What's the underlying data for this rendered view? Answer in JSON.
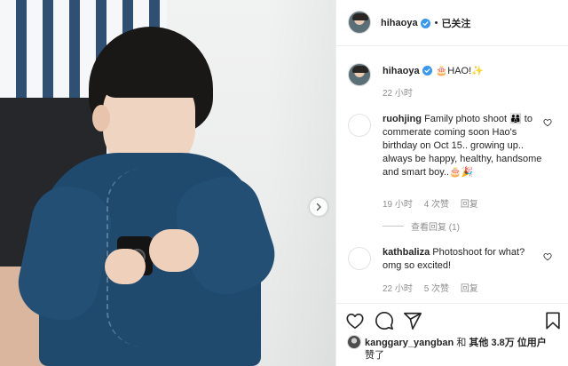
{
  "post": {
    "username": "hihaoya",
    "follow_status": "已关注",
    "separator": "•",
    "caption": "🎂HAO!✨",
    "caption_time": "22 小时"
  },
  "comments": [
    {
      "username": "ruohjing",
      "text": "Family photo shoot 👨‍👩‍👦 to commerate coming soon Hao's birthday on Oct 15.. growing up.. always be happy, healthy, handsome and smart boy..🎂🎉",
      "time": "19 小时",
      "likes": "4 次赞",
      "reply": "回复",
      "view_replies": "查看回复 (1)"
    },
    {
      "username": "kathbaliza",
      "text": "Photoshoot for what? omg so excited!",
      "time": "22 小时",
      "likes": "5 次赞",
      "reply": "回复"
    }
  ],
  "likes_line": {
    "liker": "kanggary_yangban",
    "conj": " 和 ",
    "others": "其他 3.8万 位用户",
    "suffix": "赞了"
  },
  "icons": [
    "verified-badge-icon",
    "next-arrow-icon",
    "heart-icon",
    "comment-icon",
    "share-icon",
    "bookmark-icon"
  ],
  "colors": {
    "verified": "#3897f0",
    "muted": "#8e8e8e",
    "text": "#262626",
    "border": "#efefef"
  }
}
